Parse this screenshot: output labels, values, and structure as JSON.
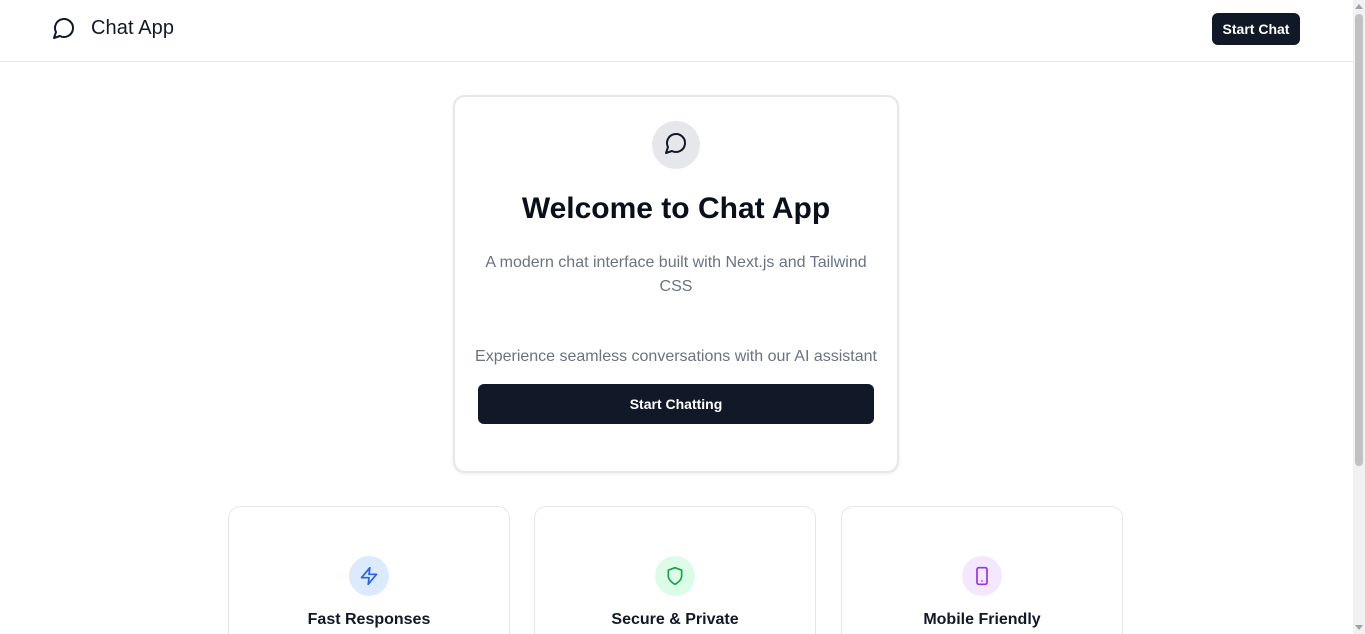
{
  "header": {
    "app_title": "Chat App",
    "logo_icon": "message-circle-icon",
    "start_chat_label": "Start Chat"
  },
  "welcome": {
    "icon": "message-circle-icon",
    "heading": "Welcome to Chat App",
    "subtitle": "A modern chat interface built with Next.js and Tailwind CSS",
    "tagline": "Experience seamless conversations with our AI assistant",
    "cta_label": "Start Chatting"
  },
  "features": [
    {
      "title": "Fast Responses",
      "icon": "zap-icon",
      "icon_color": "#2563eb",
      "icon_bg": "#dbeafe"
    },
    {
      "title": "Secure & Private",
      "icon": "shield-icon",
      "icon_color": "#16a34a",
      "icon_bg": "#dcfce7"
    },
    {
      "title": "Mobile Friendly",
      "icon": "smartphone-icon",
      "icon_color": "#9333ea",
      "icon_bg": "#f3e8ff"
    }
  ],
  "colors": {
    "primary": "#111827",
    "muted_text": "#6b7280",
    "border": "#e5e7eb"
  }
}
